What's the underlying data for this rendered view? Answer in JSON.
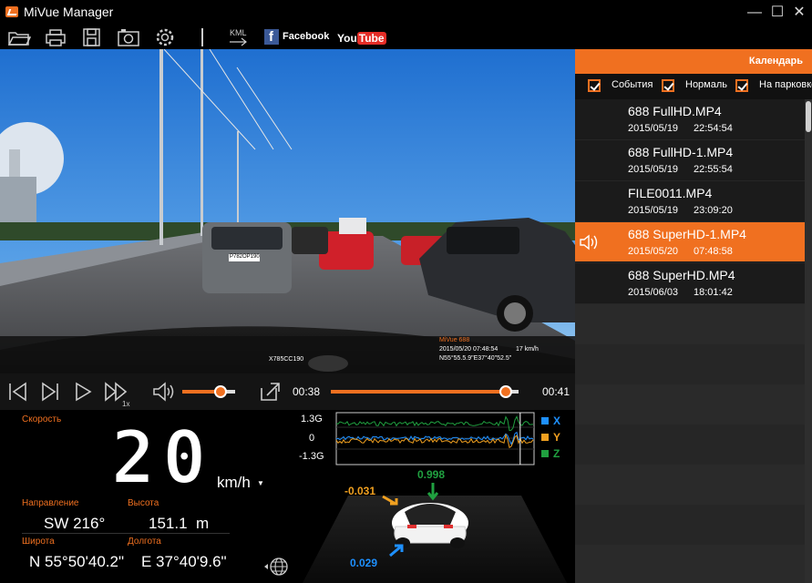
{
  "window": {
    "title": "MiVue Manager",
    "minimize": "—",
    "maximize": "☐",
    "close": "✕"
  },
  "toolbar": {
    "icons": [
      "folder-open-icon",
      "print-icon",
      "save-icon",
      "camera-icon",
      "gear-icon"
    ],
    "kml_label": "KML",
    "facebook_label": "Facebook",
    "youtube_label_you": "You",
    "youtube_label_tube": "Tube"
  },
  "video": {
    "plate_top": "X785CC190",
    "overlay_model": "MiVue 688",
    "overlay_datetime": "2015/05/20 07:48:54",
    "overlay_speed": "17 km/h",
    "overlay_coords": "N55°55.5.9\"E37°40\"52.5\"",
    "car_plate": "Р782ОР190"
  },
  "controls": {
    "speed_label": "1x",
    "volume_level": 0.72,
    "time_current": "00:38",
    "time_total": "00:41",
    "progress": 0.93
  },
  "info": {
    "speed_label": "Скорость",
    "speed_value": "20",
    "speed_unit": "km/h",
    "direction_label": "Направление",
    "direction_value": "SW 216°",
    "altitude_label": "Высота",
    "altitude_value": "151.1  m",
    "latitude_label": "Широта",
    "latitude_value": "N 55°50'40.2\"",
    "longitude_label": "Долгота",
    "longitude_value": "E 37°40'9.6\""
  },
  "sensor": {
    "ytick_top": "1.3G",
    "ytick_mid": "0",
    "ytick_bottom": "-1.3G",
    "legend": [
      {
        "label": "X",
        "color": "#1e90ff"
      },
      {
        "label": "Y",
        "color": "#f0a020"
      },
      {
        "label": "Z",
        "color": "#20a040"
      }
    ],
    "value_x": "-0.031",
    "value_z": "0.998",
    "value_y": "0.029",
    "marker_position": 0.93
  },
  "panel": {
    "calendar_label": "Календарь",
    "filters": [
      {
        "label": "События",
        "checked": true
      },
      {
        "label": "Нормальный",
        "checked": true
      },
      {
        "label": "На парковке",
        "checked": true
      }
    ],
    "files": [
      {
        "name": "688 FullHD.MP4",
        "date": "2015/05/19",
        "time": "22:54:54",
        "selected": false
      },
      {
        "name": "688 FullHD-1.MP4",
        "date": "2015/05/19",
        "time": "22:55:54",
        "selected": false
      },
      {
        "name": "FILE0011.MP4",
        "date": "2015/05/19",
        "time": "23:09:20",
        "selected": false
      },
      {
        "name": "688 SuperHD-1.MP4",
        "date": "2015/05/20",
        "time": "07:48:58",
        "selected": true
      },
      {
        "name": "688 SuperHD.MP4",
        "date": "2015/06/03",
        "time": "18:01:42",
        "selected": false
      }
    ]
  },
  "colors": {
    "accent": "#f07020",
    "selected_row": "#f07020"
  }
}
